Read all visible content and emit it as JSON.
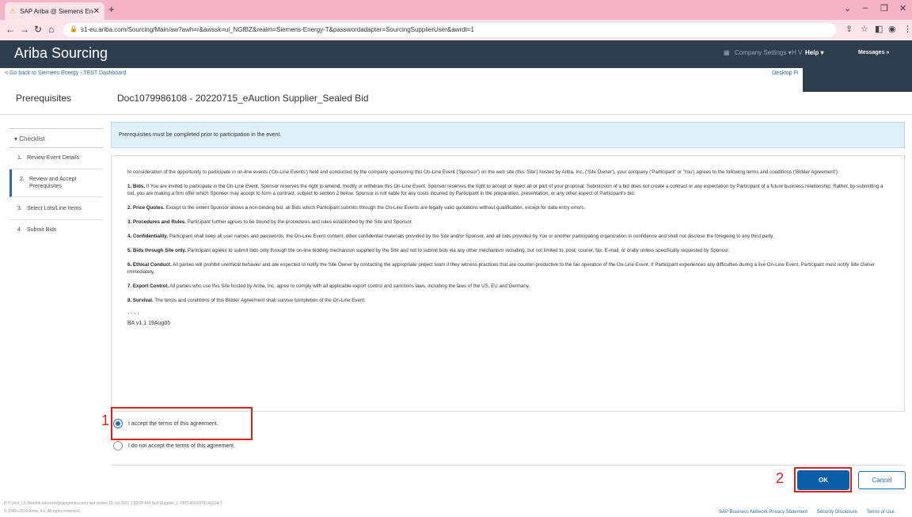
{
  "browser": {
    "tab_title": "SAP Ariba @ Siemens Energy",
    "url": "s1-eu.ariba.com/Sourcing/Main/aw?awh=r&awssk=ul_NGfBZ&realm=Siemens-Energy-T&passwordadapter=SourcingSupplierUser&awrdt=1"
  },
  "header": {
    "brand": "Ariba Sourcing",
    "company_settings": "Company Settings ▾",
    "user": "H V",
    "help": "Help ▾",
    "messages": "Messages »"
  },
  "nav": {
    "go_back": "< Go back to Siemens Energy - TEST Dashboard",
    "desktop_file": "Desktop Fi"
  },
  "page": {
    "section": "Prerequisites",
    "doc_title": "Doc1079986108 - 20220715_eAuction Supplier_Sealed Bid",
    "info": "Prerequisites must be completed prior to participation in the event."
  },
  "checklist": {
    "header": "▾ Checklist",
    "items": [
      {
        "num": "1.",
        "label": "Review Event Details"
      },
      {
        "num": "2.",
        "label": "Review and Accept Prerequisites"
      },
      {
        "num": "3.",
        "label": "Select Lots/Line Items"
      },
      {
        "num": "4.",
        "label": "Submit Bids"
      }
    ]
  },
  "terms": {
    "intro": "In consideration of the opportunity to participate in on-line events ('On-Line Events') held and conducted by the company sponsoring this On-Line Event ('Sponsor') on the web site (this 'Site') hosted by Ariba, Inc. ('Site Owner'), your company ('Participant' or 'You') agrees to the following terms and conditions ('Bidder Agreement'):",
    "clauses": [
      {
        "title": "1. Bids.",
        "text": " If You are invited to participate in the On-Line Event, Sponsor reserves the right to amend, modify or withdraw this On-Line Event. Sponsor reserves the right to accept or reject all or part of your proposal. Submission of a bid does not create a contract or any expectation by Participant of a future business relationship. Rather, by submitting a bid, you are making a firm offer which Sponsor may accept to form a contract, subject to section 2 below. Sponsor is not liable for any costs incurred by Participant in the preparation, presentation, or any other aspect of Participant's bid."
      },
      {
        "title": "2. Price Quotes.",
        "text": " Except to the extent Sponsor allows a non-binding bid, all Bids which Participant submits through the On-Line Events are legally valid quotations without qualification, except for data entry errors."
      },
      {
        "title": "3. Procedures and Rules.",
        "text": " Participant further agrees to be bound by the procedures and rules established by the Site and Sponsor."
      },
      {
        "title": "4. Confidentiality.",
        "text": " Participant shall keep all user names and passwords, the On-Line Event content, other confidential materials provided by the Site and/or Sponsor, and all bids provided by You or another participating organization in confidence and shall not disclose the foregoing to any third party."
      },
      {
        "title": "5. Bids through Site only.",
        "text": " Participant agrees to submit bids only through the on-line bidding mechanism supplied by the Site and not to submit bids via any other mechanism including, but not limited to, post, courier, fax, E-mail, or orally unless specifically requested by Sponsor."
      },
      {
        "title": "6. Ethical Conduct.",
        "text": " All parties will prohibit unethical behavior and are expected to notify the Site Owner by contacting the appropriate project team if they witness practices that are counter-productive to the fair operation of the On-Line Event. If Participant experiences any difficulties during a live On-Line Event, Participant must notify Site Owner immediately."
      },
      {
        "title": "7. Export Control.",
        "text": " All parties who use this Site hosted by Ariba, Inc. agree to comply with all applicable export control and sanctions laws, including the laws of the US, EU and Germany."
      },
      {
        "title": "8. Survival.",
        "text": " The terms and conditions of this Bidder Agreement shall survive completion of the On-Line Event."
      }
    ],
    "stars": "* * * *",
    "version": "BA v1.1 19Aug05"
  },
  "options": {
    "accept": "I accept the terms of this agreement.",
    "decline": "I do not accept the terms of this agreement."
  },
  "markers": {
    "one": "1",
    "two": "2"
  },
  "buttons": {
    "ok": "OK",
    "cancel": "Cancel"
  },
  "footer": {
    "line1": "H V (test_LK-hendrik.uterreck@capgemini.com) last visited 15 Jul 2022 1:53:05 AM  Test Supplier_L 2005  AN11079141334-T",
    "line2": "© 1996–2019 Ariba, Inc. All rights reserved.",
    "links": [
      "SAP Business Network Privacy Statement",
      "Security Disclosure",
      "Terms of Use"
    ]
  }
}
